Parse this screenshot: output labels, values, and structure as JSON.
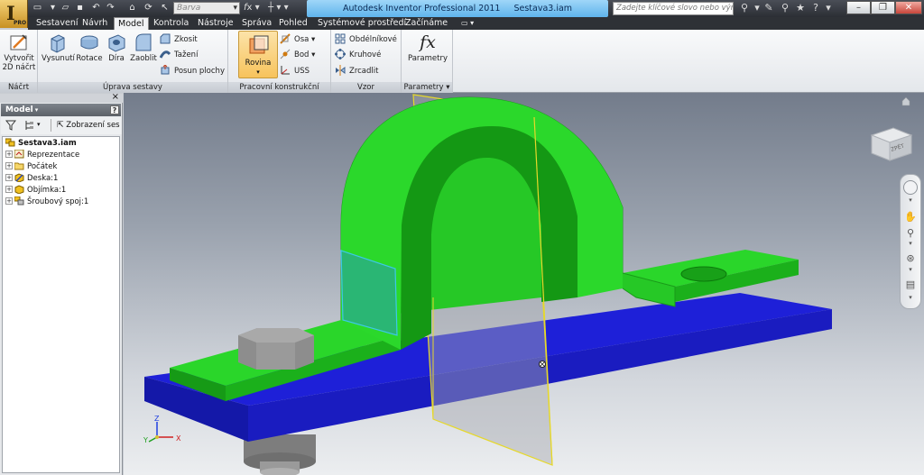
{
  "window": {
    "app_title": "Autodesk Inventor Professional 2011",
    "doc_title": "Sestava3.iam",
    "pro_badge": "PRO"
  },
  "quick_access": {
    "color_value": "Barva",
    "search_placeholder": "Zadejte klíčové slovo nebo výraz."
  },
  "tabs": [
    {
      "label": "Sestavení"
    },
    {
      "label": "Návrh"
    },
    {
      "label": "Model"
    },
    {
      "label": "Kontrola"
    },
    {
      "label": "Nástroje"
    },
    {
      "label": "Správa"
    },
    {
      "label": "Pohled"
    },
    {
      "label": "Systémové prostředí"
    },
    {
      "label": "Začínáme"
    }
  ],
  "active_tab": "Model",
  "ribbon": {
    "sketch_panel": {
      "title": "Náčrt",
      "create_line1": "Vytvořit",
      "create_line2": "2D náčrt"
    },
    "modify_panel": {
      "title": "Úprava sestavy",
      "extrude": "Vysunutí",
      "revolve": "Rotace",
      "hole": "Díra",
      "fillet": "Zaoblit",
      "chamfer": "Zkosit",
      "sweep": "Tažení",
      "move_face": "Posun plochy"
    },
    "workfeatures_panel": {
      "title": "Pracovní konstrukční prvky",
      "plane": "Rovina",
      "axis": "Osa",
      "point": "Bod",
      "ucs": "USS"
    },
    "pattern_panel": {
      "title": "Vzor",
      "rectangular": "Obdélníkové",
      "circular": "Kruhové",
      "mirror": "Zrcadlit"
    },
    "params_panel": {
      "title": "Parametry",
      "parameters": "Parametry",
      "fx": "fx"
    }
  },
  "browser": {
    "title": "Model",
    "view_label": "Zobrazení ses",
    "tree": [
      {
        "label": "Sestava3.iam"
      },
      {
        "label": "Reprezentace"
      },
      {
        "label": "Počátek"
      },
      {
        "label": "Deska:1"
      },
      {
        "label": "Objímka:1"
      },
      {
        "label": "Šroubový spoj:1"
      }
    ]
  },
  "viewcube": {
    "face_label": "ZPĚT"
  },
  "triad": {
    "x": "X",
    "y": "Y",
    "z": "Z"
  },
  "colors": {
    "plate_blue": "#1c1fc8",
    "clamp_green": "#23c223",
    "bolt_gray": "#8d8d8d",
    "plane_yellow": "#e6d82a",
    "ribbon_active": "#f7c35c"
  }
}
